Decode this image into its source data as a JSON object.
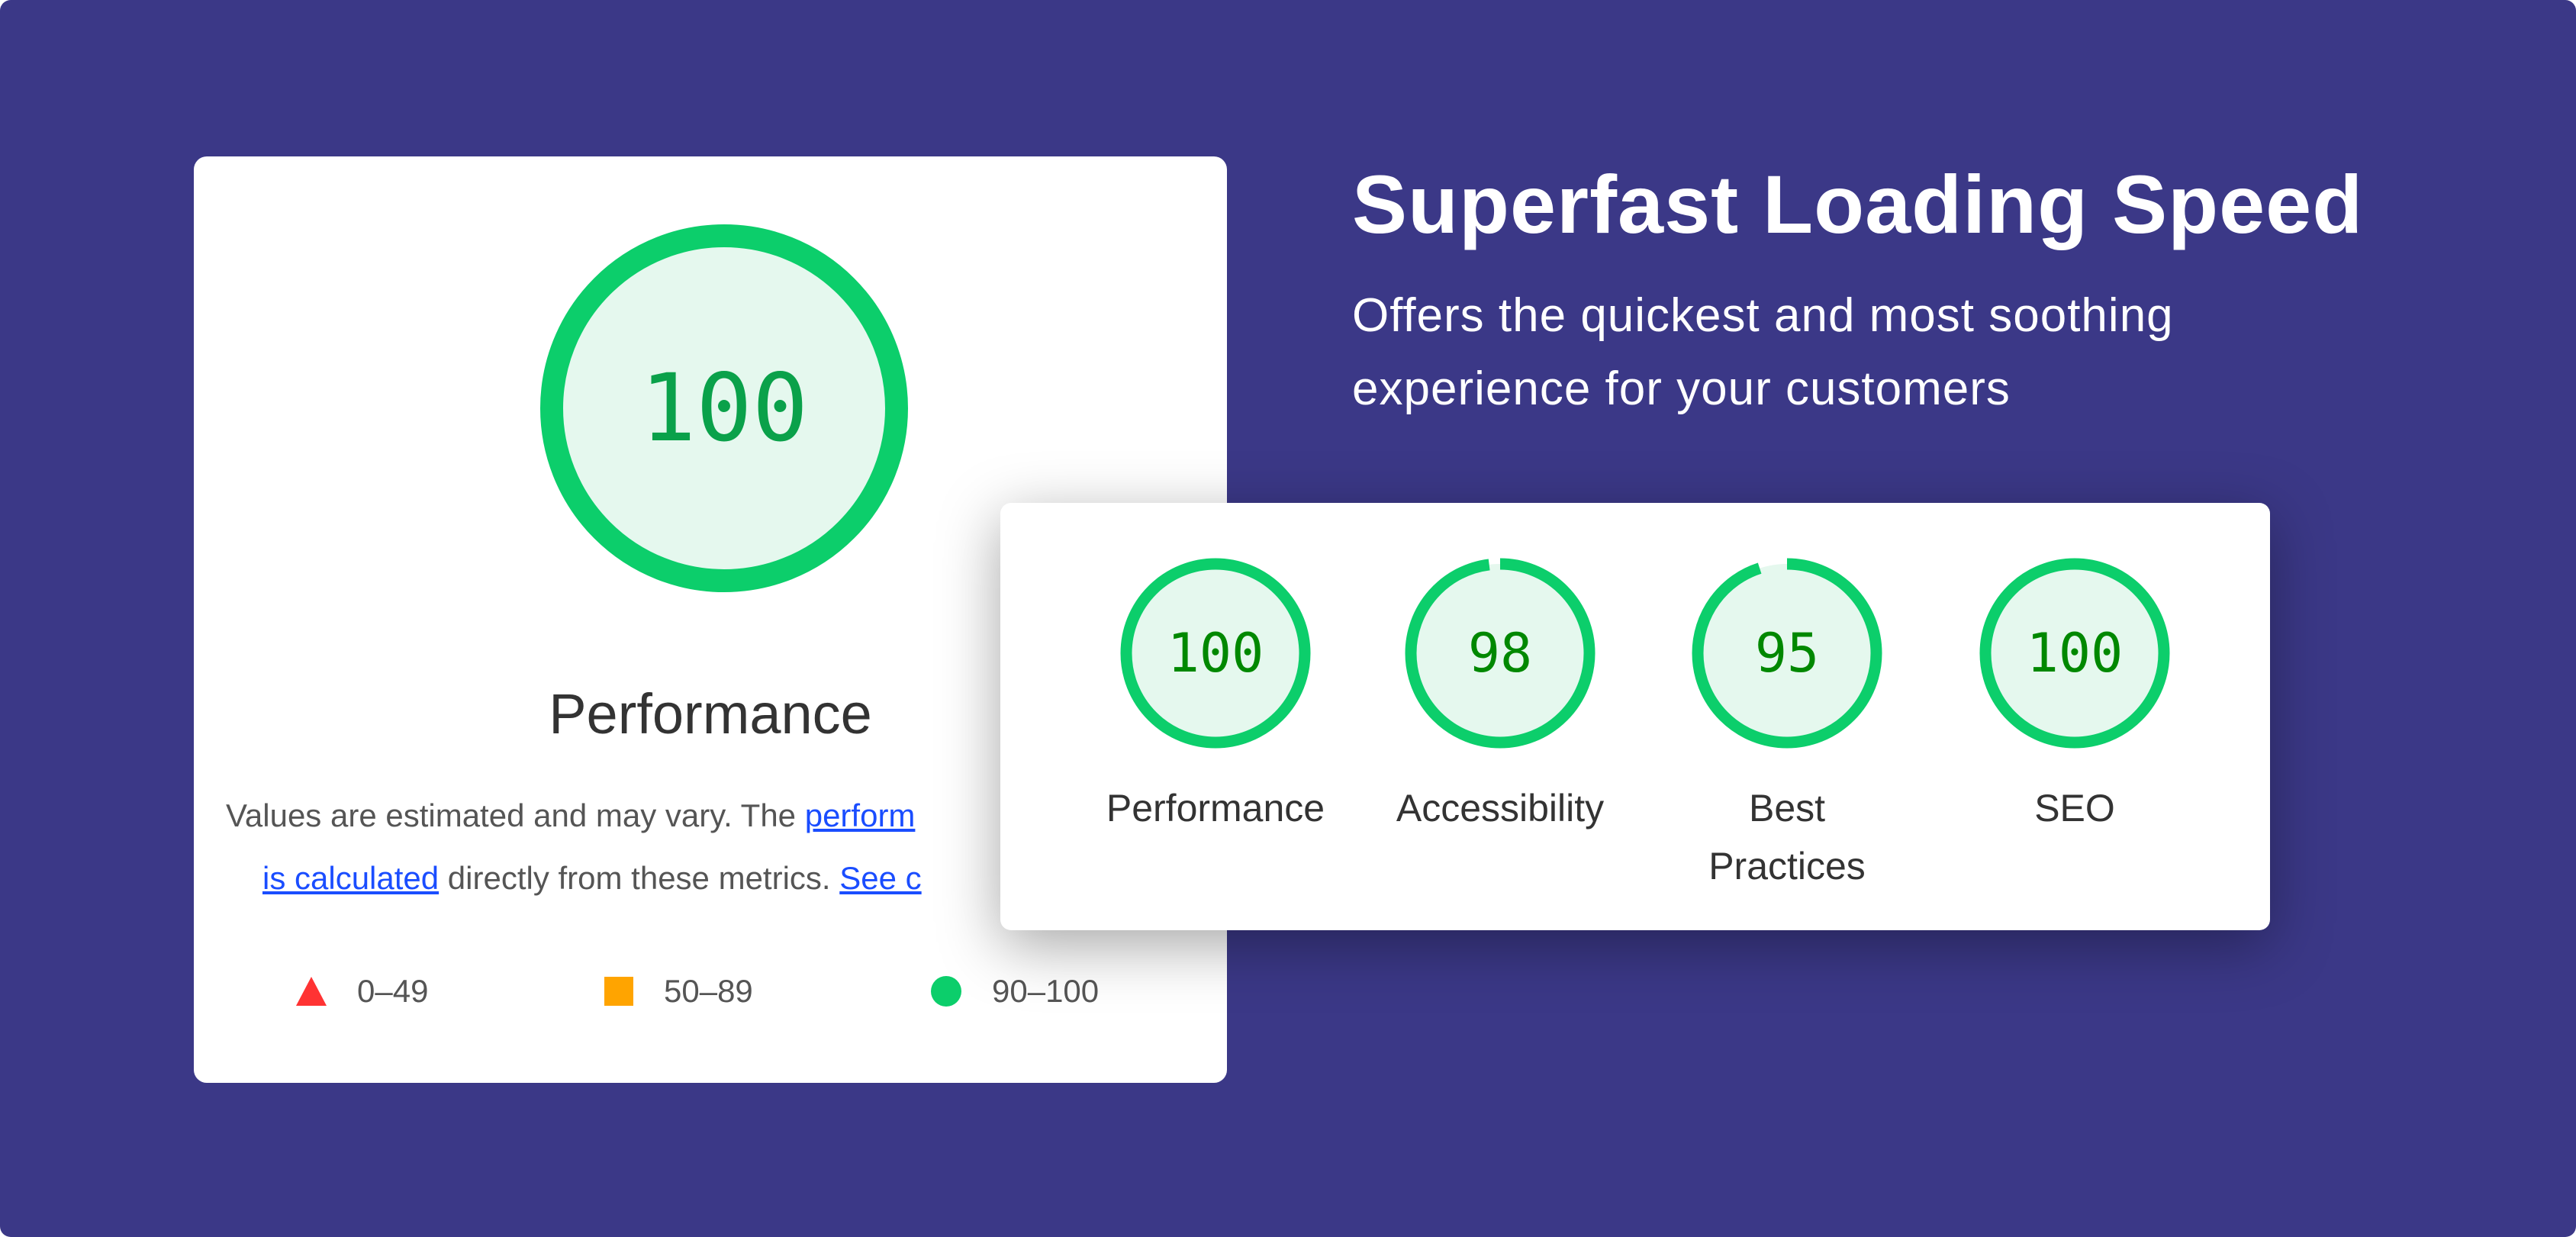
{
  "colors": {
    "background": "#3b3887",
    "pass": "#0cce6b",
    "pass_fill": "#e5f8ee",
    "average": "#ffa400",
    "fail": "#ff3333",
    "link": "#1a4dff"
  },
  "left_card": {
    "score": 100,
    "title": "Performance",
    "desc_line1_text": "Values are estimated and may vary. The ",
    "desc_line1_link": "perform",
    "desc_line2_link": "is calculated",
    "desc_line2_text": " directly from these metrics. ",
    "desc_line2_link2": "See c",
    "legend": [
      {
        "icon": "triangle-icon",
        "label": "0–49"
      },
      {
        "icon": "square-icon",
        "label": "50–89"
      },
      {
        "icon": "circle-icon",
        "label": "90–100"
      }
    ]
  },
  "hero": {
    "title": "Superfast Loading Speed",
    "subtitle_line1": "Offers the quickest and most soothing",
    "subtitle_line2": "experience for your customers"
  },
  "scores": [
    {
      "label": "Performance",
      "score": 100
    },
    {
      "label": "Accessibility",
      "score": 98
    },
    {
      "label": "Best Practices",
      "score": 95
    },
    {
      "label": "SEO",
      "score": 100
    }
  ]
}
